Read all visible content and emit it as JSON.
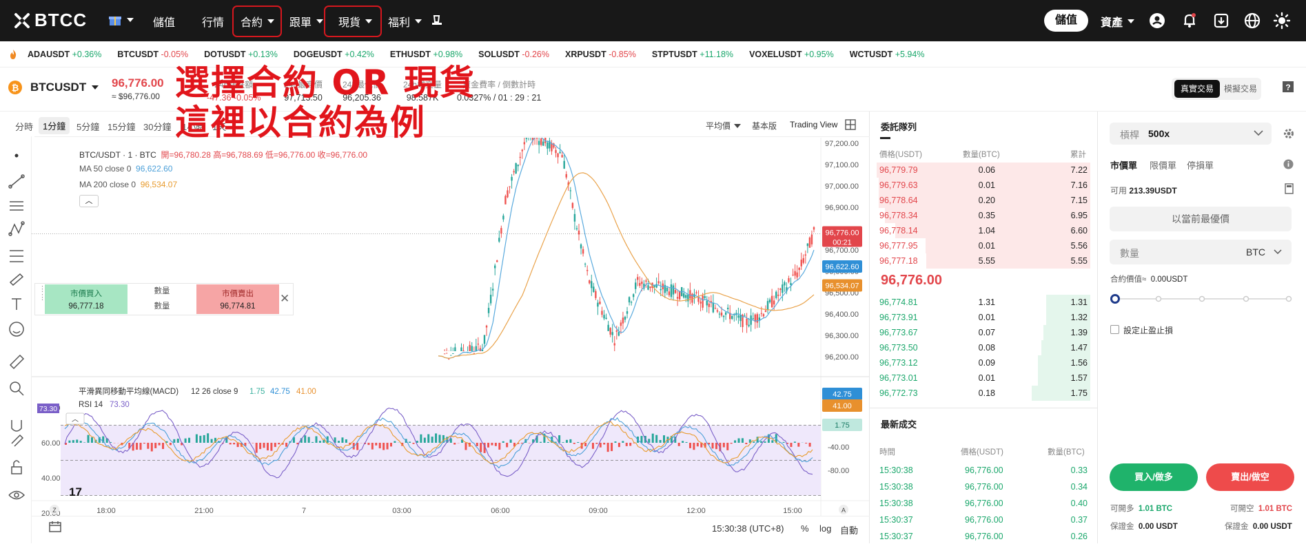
{
  "nav": {
    "brand": "BTCC",
    "items": [
      "儲值",
      "行情",
      "合約",
      "跟單",
      "現貨",
      "福利"
    ],
    "deposit_btn": "儲值",
    "assets": "資產"
  },
  "annotation": {
    "line1": "選擇合約 OR 現貨",
    "line2": "這裡以合約為例"
  },
  "tickers": [
    {
      "sym": "ADAUSDT",
      "chg": "+0.36%",
      "dir": "pos"
    },
    {
      "sym": "BTCUSDT",
      "chg": "-0.05%",
      "dir": "neg"
    },
    {
      "sym": "DOTUSDT",
      "chg": "+0.13%",
      "dir": "pos"
    },
    {
      "sym": "DOGEUSDT",
      "chg": "+0.42%",
      "dir": "pos"
    },
    {
      "sym": "ETHUSDT",
      "chg": "+0.98%",
      "dir": "pos"
    },
    {
      "sym": "SOLUSDT",
      "chg": "-0.26%",
      "dir": "neg"
    },
    {
      "sym": "XRPUSDT",
      "chg": "-0.85%",
      "dir": "neg"
    },
    {
      "sym": "STPTUSDT",
      "chg": "+11.18%",
      "dir": "pos"
    },
    {
      "sym": "VOXELUSDT",
      "chg": "+0.95%",
      "dir": "pos"
    },
    {
      "sym": "WCTUSDT",
      "chg": "+5.94%",
      "dir": "pos"
    }
  ],
  "symbol": {
    "name": "BTCUSDT",
    "price": "96,776.00",
    "usd": "≈ $96,776.00",
    "stats": [
      {
        "label": "24h漲跌額",
        "value": "-47.36  -0.05%"
      },
      {
        "label": "24h最高價",
        "value": "97,713.50"
      },
      {
        "label": "24h最低價",
        "value": "96,205.36"
      },
      {
        "label": "24h成交量",
        "value": "98.587K"
      },
      {
        "label": "資金費率 / 倒數計時",
        "value": "0.0327% / 01 : 29 : 21"
      }
    ],
    "real_trade": "真實交易",
    "demo_trade": "模擬交易"
  },
  "chart": {
    "timeframes": [
      "分時",
      "1分鐘",
      "5分鐘",
      "15分鐘",
      "30分鐘",
      "1小時",
      "1天"
    ],
    "active_tf": "1分鐘",
    "price_type": "平均價",
    "basic": "基本版",
    "tv": "Trading View",
    "ohlc_title": "BTC/USDT · 1 · BTC",
    "ohlc": "開=96,780.28 高=96,788.69 低=96,776.00 收=96,776.00",
    "ma50": "MA 50 close 0",
    "ma50_val": "96,622.60",
    "ma200": "MA 200 close 0",
    "ma200_val": "96,534.07",
    "y_ticks": [
      "97,200.00",
      "97,100.00",
      "97,000.00",
      "96,900.00",
      "96,800.00",
      "96,700.00",
      "96,600.00",
      "96,500.00",
      "96,400.00",
      "96,300.00",
      "96,200.00"
    ],
    "last_price": "96,776.00",
    "countdown": "00:21",
    "macd_title": "平滑異同移動平均線(MACD)",
    "macd_params": "12 26 close 9",
    "macd_v1": "1.75",
    "macd_v2": "42.75",
    "macd_v3": "41.00",
    "rsi_title": "RSI 14",
    "rsi_val": "73.30",
    "rsi_ticks": [
      "80.00",
      "60.00",
      "40.00",
      "20.00"
    ],
    "macd_ticks": [
      "-40.00",
      "-80.00"
    ],
    "x_ticks": [
      "18:00",
      "21:00",
      "7",
      "03:00",
      "06:00",
      "09:00",
      "12:00",
      "15:00"
    ],
    "time": "15:30:38 (UTC+8)",
    "pct": "%",
    "log": "log",
    "auto": "自動"
  },
  "quick_trade": {
    "buy_label": "市價買入",
    "buy_price": "96,777.18",
    "qty": "數量",
    "sell_label": "市價賣出",
    "sell_price": "96,774.81"
  },
  "orderbook": {
    "title": "委託隊列",
    "headers": [
      "價格(USDT)",
      "數量(BTC)",
      "累計"
    ],
    "asks": [
      [
        "96,779.79",
        "0.06",
        "7.22"
      ],
      [
        "96,779.63",
        "0.01",
        "7.16"
      ],
      [
        "96,778.64",
        "0.20",
        "7.15"
      ],
      [
        "96,778.34",
        "0.35",
        "6.95"
      ],
      [
        "96,778.14",
        "1.04",
        "6.60"
      ],
      [
        "96,777.95",
        "0.01",
        "5.56"
      ],
      [
        "96,777.18",
        "5.55",
        "5.55"
      ]
    ],
    "mid": "96,776.00",
    "bids": [
      [
        "96,774.81",
        "1.31",
        "1.31"
      ],
      [
        "96,773.91",
        "0.01",
        "1.32"
      ],
      [
        "96,773.67",
        "0.07",
        "1.39"
      ],
      [
        "96,773.50",
        "0.08",
        "1.47"
      ],
      [
        "96,773.12",
        "0.09",
        "1.56"
      ],
      [
        "96,773.01",
        "0.01",
        "1.57"
      ],
      [
        "96,772.73",
        "0.18",
        "1.75"
      ]
    ]
  },
  "trades": {
    "title": "最新成交",
    "headers": [
      "時間",
      "價格(USDT)",
      "數量(BTC)"
    ],
    "rows": [
      [
        "15:30:38",
        "96,776.00",
        "0.33"
      ],
      [
        "15:30:38",
        "96,776.00",
        "0.34"
      ],
      [
        "15:30:38",
        "96,776.00",
        "0.40"
      ],
      [
        "15:30:37",
        "96,776.00",
        "0.37"
      ],
      [
        "15:30:37",
        "96,776.00",
        "0.26"
      ]
    ]
  },
  "order_form": {
    "leverage_label": "槓桿",
    "leverage": "500x",
    "tabs": [
      "市價單",
      "限價單",
      "停損單"
    ],
    "avail_label": "可用",
    "avail": "213.39USDT",
    "best_price": "以當前最優價",
    "qty_placeholder": "數量",
    "unit": "BTC",
    "contract_value": "合約價值≈",
    "contract_value_val": "0.00USDT",
    "tpsl": "設定止盈止損",
    "buy_btn": "買入/做多",
    "sell_btn": "賣出/做空",
    "can_long": "可開多",
    "can_long_val": "1.01 BTC",
    "can_short": "可開空",
    "can_short_val": "1.01 BTC",
    "margin": "保證金",
    "margin_long": "0.00 USDT",
    "margin_short": "0.00 USDT"
  }
}
